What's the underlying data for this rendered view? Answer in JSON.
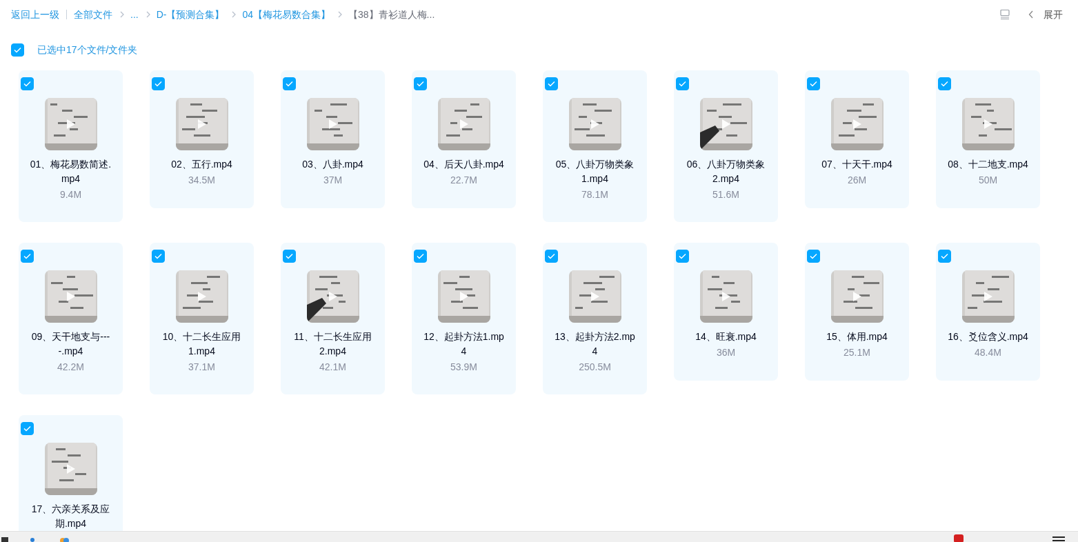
{
  "breadcrumb": {
    "back": "返回上一级",
    "items": [
      {
        "label": "全部文件",
        "current": false
      },
      {
        "label": "...",
        "current": false
      },
      {
        "label": "D-【预测合集】",
        "current": false
      },
      {
        "label": "04【梅花易数合集】",
        "current": false
      },
      {
        "label": "【38】青衫道人梅...",
        "current": true
      }
    ]
  },
  "toolbar": {
    "expand_label": "展开"
  },
  "selection": {
    "checked": true,
    "label": "已选中17个文件/文件夹"
  },
  "files": [
    {
      "name": "01、梅花易数简述.mp4",
      "size": "9.4M",
      "checked": true
    },
    {
      "name": "02、五行.mp4",
      "size": "34.5M",
      "checked": true
    },
    {
      "name": "03、八卦.mp4",
      "size": "37M",
      "checked": true
    },
    {
      "name": "04、后天八卦.mp4",
      "size": "22.7M",
      "checked": true
    },
    {
      "name": "05、八卦万物类象1.mp4",
      "size": "78.1M",
      "checked": true
    },
    {
      "name": "06、八卦万物类象2.mp4",
      "size": "51.6M",
      "checked": true
    },
    {
      "name": "07、十天干.mp4",
      "size": "26M",
      "checked": true
    },
    {
      "name": "08、十二地支.mp4",
      "size": "50M",
      "checked": true
    },
    {
      "name": "09、天干地支与----.mp4",
      "size": "42.2M",
      "checked": true
    },
    {
      "name": "10、十二长生应用1.mp4",
      "size": "37.1M",
      "checked": true
    },
    {
      "name": "11、十二长生应用2.mp4",
      "size": "42.1M",
      "checked": true
    },
    {
      "name": "12、起卦方法1.mp4",
      "size": "53.9M",
      "checked": true
    },
    {
      "name": "13、起卦方法2.mp4",
      "size": "250.5M",
      "checked": true
    },
    {
      "name": "14、旺衰.mp4",
      "size": "36M",
      "checked": true
    },
    {
      "name": "15、体用.mp4",
      "size": "25.1M",
      "checked": true
    },
    {
      "name": "16、爻位含义.mp4",
      "size": "48.4M",
      "checked": true
    },
    {
      "name": "17、六亲关系及应期.mp4",
      "checked": true
    }
  ]
}
